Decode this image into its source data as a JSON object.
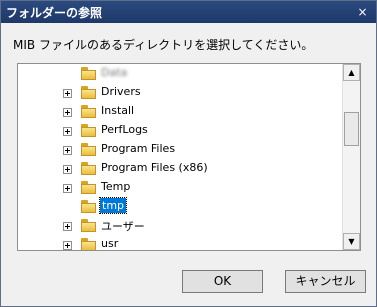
{
  "window": {
    "title": "フォルダーの参照",
    "close_glyph": "×"
  },
  "instruction": "MIB ファイルのあるディレクトリを選択してください。",
  "tree": {
    "items": [
      {
        "label": "Data",
        "expander": false,
        "selected": false,
        "blurred": true
      },
      {
        "label": "Drivers",
        "expander": true,
        "selected": false
      },
      {
        "label": "Install",
        "expander": true,
        "selected": false
      },
      {
        "label": "PerfLogs",
        "expander": true,
        "selected": false
      },
      {
        "label": "Program Files",
        "expander": true,
        "selected": false
      },
      {
        "label": "Program Files (x86)",
        "expander": true,
        "selected": false
      },
      {
        "label": "Temp",
        "expander": true,
        "selected": false
      },
      {
        "label": "tmp",
        "expander": false,
        "selected": true
      },
      {
        "label": "ユーザー",
        "expander": true,
        "selected": false
      },
      {
        "label": "usr",
        "expander": true,
        "selected": false
      }
    ],
    "scroll_up": "▲",
    "scroll_down": "▼"
  },
  "buttons": {
    "ok": "OK",
    "cancel": "キャンセル"
  }
}
